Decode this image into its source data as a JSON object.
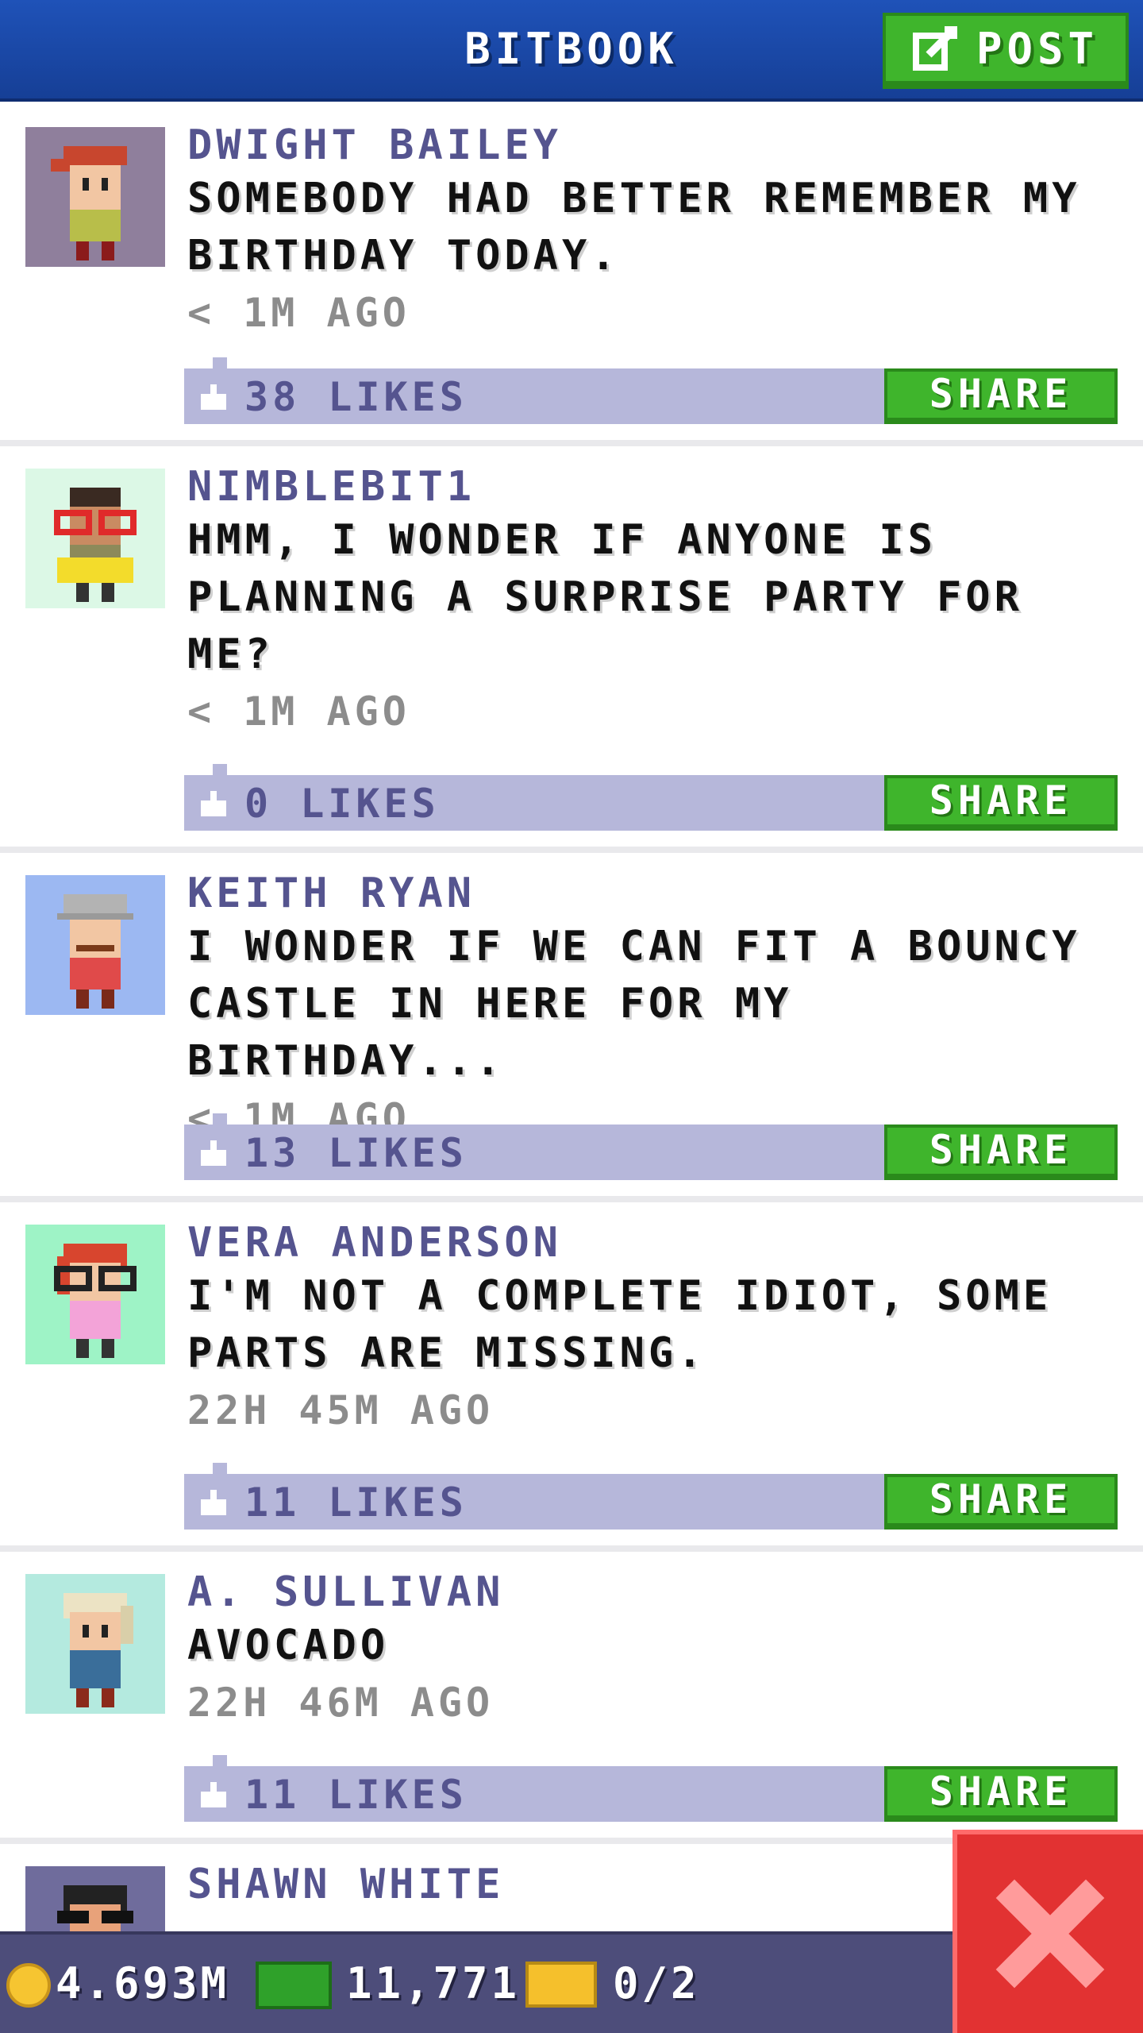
{
  "header": {
    "title": "BITBOOK",
    "post_label": "POST"
  },
  "posts": [
    {
      "name": "DWIGHT BAILEY",
      "message_lines": [
        "SOMEBODY HAD BETTER REMEMBER MY",
        "BIRTHDAY TODAY."
      ],
      "time": "< 1M AGO",
      "likes": "38 LIKES",
      "share_label": "SHARE",
      "avatar_bg": "#8f7f9c",
      "avatar_icon": "man-red-cap-avatar"
    },
    {
      "name": "NIMBLEBIT1",
      "message_lines": [
        "HMM, I WONDER IF ANYONE IS",
        "PLANNING A SURPRISE PARTY FOR",
        "ME?"
      ],
      "time": "< 1M AGO",
      "likes": "0 LIKES",
      "share_label": "SHARE",
      "avatar_bg": "#dcf8e6",
      "avatar_icon": "kid-red-glasses-avatar"
    },
    {
      "name": "KEITH RYAN",
      "message_lines": [
        "I WONDER IF WE CAN FIT A BOUNCY",
        "CASTLE IN HERE FOR MY BIRTHDAY..."
      ],
      "time": "< 1M AGO",
      "likes": "13 LIKES",
      "share_label": "SHARE",
      "avatar_bg": "#9cb8f2",
      "avatar_icon": "old-man-grey-hat-avatar"
    },
    {
      "name": "VERA ANDERSON",
      "message_lines": [
        "I'M NOT A COMPLETE IDIOT, SOME",
        "PARTS ARE MISSING."
      ],
      "time": "22H 45M AGO",
      "likes": "11 LIKES",
      "share_label": "SHARE",
      "avatar_bg": "#9ef3c6",
      "avatar_icon": "woman-red-hair-glasses-avatar"
    },
    {
      "name": "A. SULLIVAN",
      "message_lines": [
        "AVOCADO"
      ],
      "time": "22H 46M AGO",
      "likes": "11 LIKES",
      "share_label": "SHARE",
      "avatar_bg": "#b4eadf",
      "avatar_icon": "blonde-person-avatar"
    },
    {
      "name": "SHAWN WHITE",
      "message_lines": [],
      "time": "",
      "likes": "",
      "share_label": "",
      "avatar_bg": "#6f6c9c",
      "avatar_icon": "sunglasses-person-avatar"
    }
  ],
  "status": {
    "coins": "4.693M",
    "bux": "11,771",
    "tickets": "0/2"
  },
  "colors": {
    "header_blue": "#1f52b8",
    "button_green": "#3fb52c",
    "likes_bar": "#b6b7da",
    "name_purple": "#55548f",
    "status_bar": "#4d4d7a",
    "close_red": "#e23232"
  }
}
